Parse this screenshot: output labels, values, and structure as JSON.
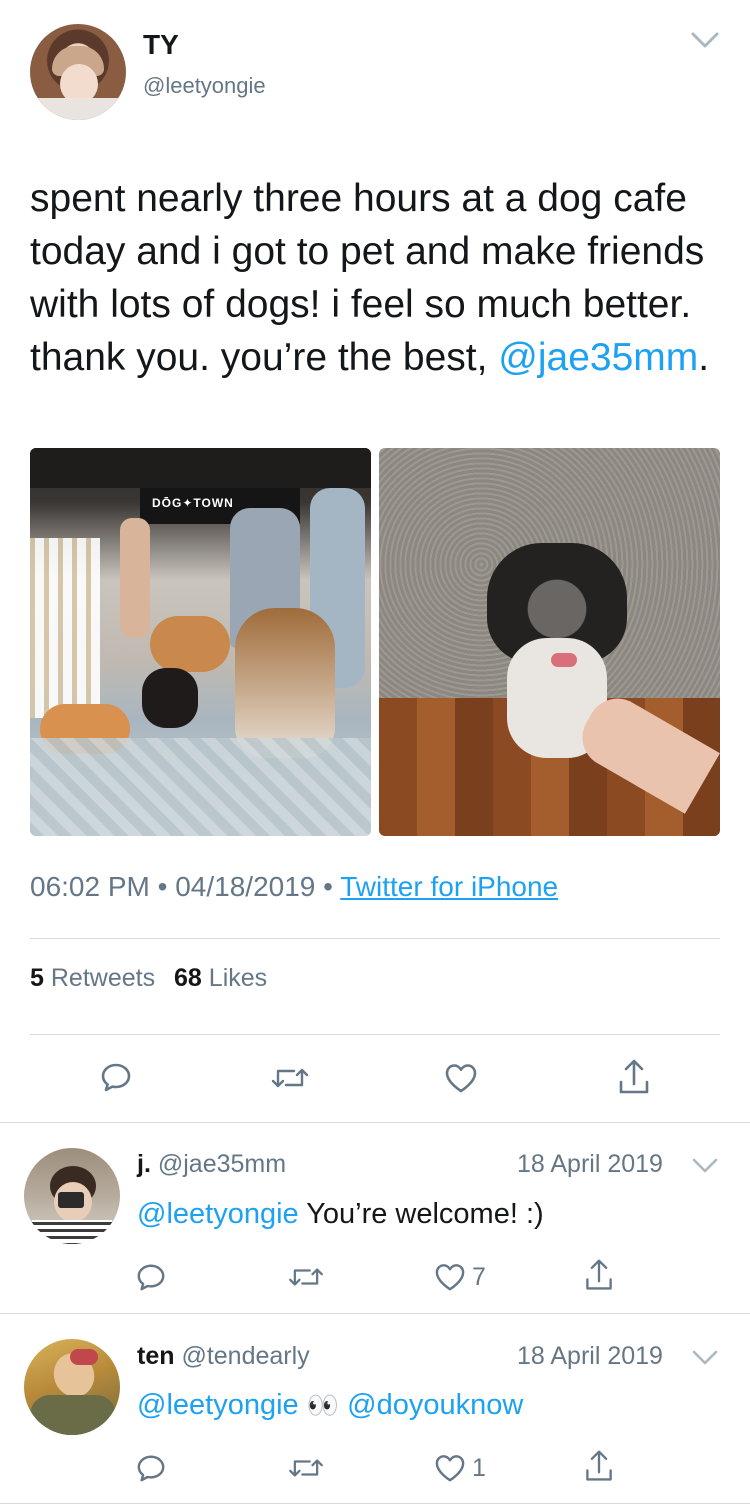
{
  "tweet": {
    "display_name": "TY",
    "handle": "@leetyongie",
    "text_before": "spent nearly three hours at a dog cafe today and i got to pet and make friends with lots of dogs! i feel so much better. thank you. you’re the best, ",
    "mention": "@jae35mm",
    "text_after": ".",
    "photo1_sign": "DŌG✦TOWN",
    "time": "06:02 PM",
    "separator": "•",
    "date": "04/18/2019",
    "source": "Twitter for iPhone",
    "retweets_count": "5",
    "retweets_label": "Retweets",
    "likes_count": "68",
    "likes_label": "Likes"
  },
  "replies": [
    {
      "display_name": "j.",
      "handle": "@jae35mm",
      "date": "18 April 2019",
      "mention": "@leetyongie",
      "text": " You’re welcome! :)",
      "like_count": "7"
    },
    {
      "display_name": "ten",
      "handle": "@tendearly",
      "date": "18 April 2019",
      "mention": "@leetyongie",
      "emoji": "👀",
      "mention2": "@doyouknow",
      "like_count": "1"
    }
  ],
  "icons": [
    "chevron-down-icon",
    "reply-icon",
    "retweet-icon",
    "like-icon",
    "share-icon"
  ],
  "colors": {
    "link": "#1da1f2",
    "muted": "#657786",
    "text": "#14171a",
    "divider": "#d6dadd"
  }
}
